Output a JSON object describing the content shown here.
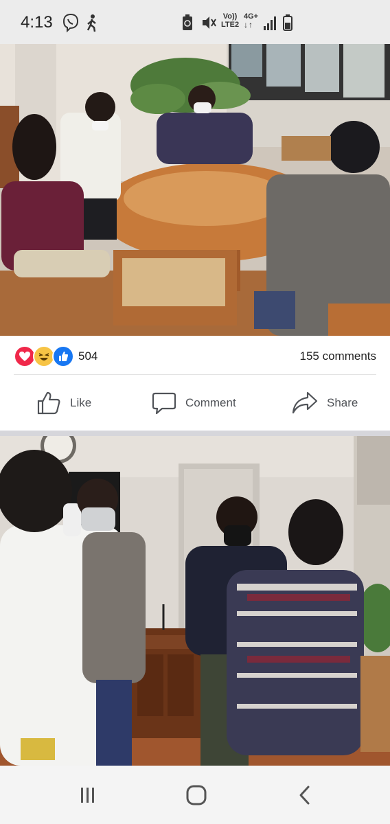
{
  "status_bar": {
    "time": "4:13",
    "network_label_top": "Vo))",
    "network_label_bottom": "LTE2",
    "data_label_top": "4G+"
  },
  "post": {
    "reactions": {
      "types": [
        "love-icon",
        "haha-icon",
        "like-icon"
      ],
      "count": "504",
      "comments": "155 comments"
    },
    "actions": {
      "like_label": "Like",
      "comment_label": "Comment",
      "share_label": "Share"
    }
  },
  "nav_bar": {
    "items": [
      "recent-apps-icon",
      "home-icon",
      "back-icon"
    ]
  }
}
